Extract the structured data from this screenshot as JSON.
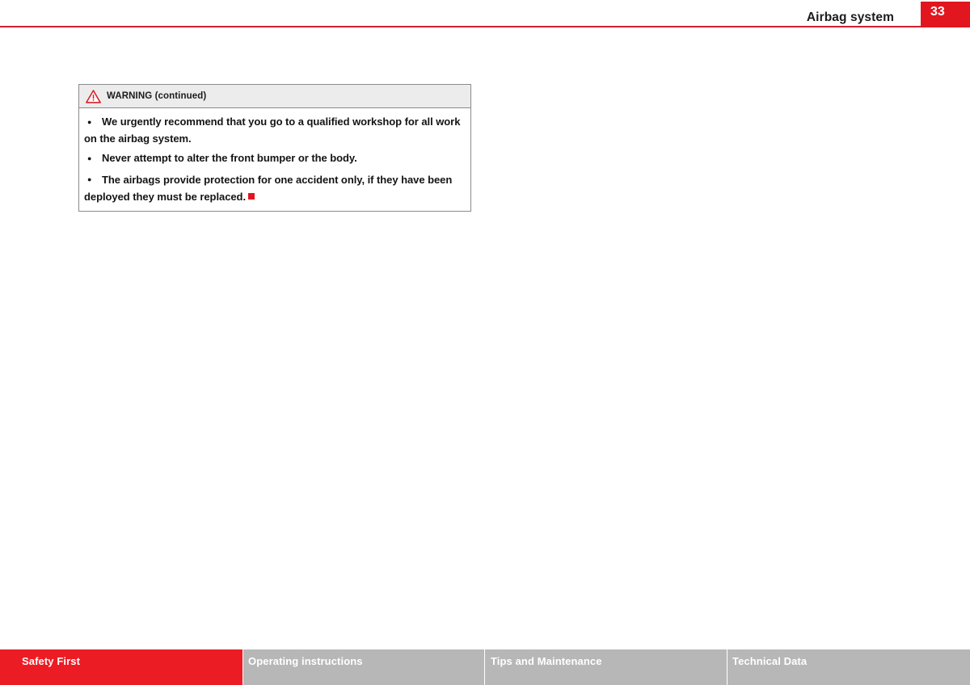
{
  "header": {
    "title": "Airbag system",
    "page_number": "33",
    "rule_color": "#cf2030",
    "page_block_color": "#e1161f"
  },
  "warning_box": {
    "icon": "warning-triangle-icon",
    "heading": "WARNING (continued)",
    "heading_bg": "#ececec",
    "border_color": "#8b8b8b",
    "items": [
      "We urgently recommend that you go to a qualified workshop for all work on the airbag system.",
      "Never attempt to alter the front bumper or the body.",
      "The airbags provide protection for one accident only, if they have been deployed they must be replaced."
    ],
    "end_marker_color": "#e1161f",
    "bullet_glyph": "●"
  },
  "footer": {
    "active_color": "#ec1c24",
    "inactive_color": "#b7b7b7",
    "tabs": [
      {
        "label": "Safety First",
        "active": true
      },
      {
        "label": "Operating instructions",
        "active": false
      },
      {
        "label": "Tips and Maintenance",
        "active": false
      },
      {
        "label": "Technical Data",
        "active": false
      }
    ]
  }
}
